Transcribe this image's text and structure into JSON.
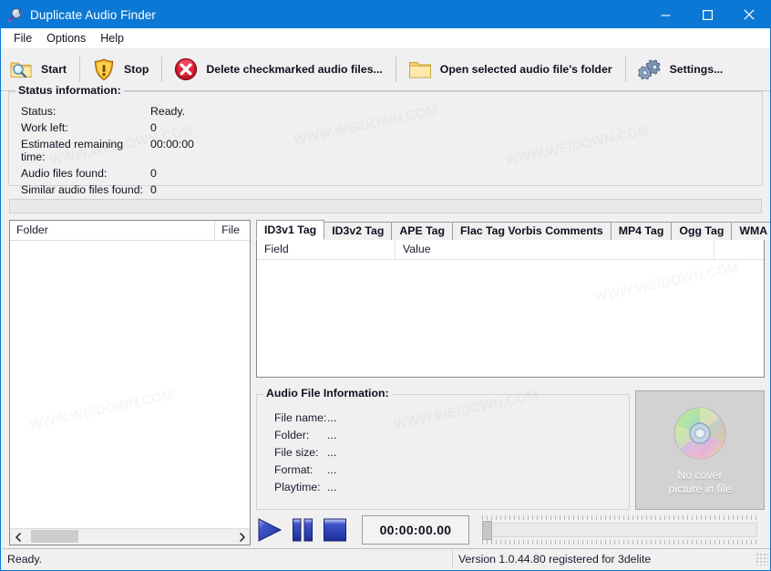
{
  "window": {
    "title": "Duplicate Audio Finder",
    "icon": "app-magnifier-icon",
    "minimize_label": "—",
    "maximize_label": "□",
    "close_label": "✕",
    "titlebar_color": "#0a78d4"
  },
  "menu": {
    "items": [
      {
        "label": "File"
      },
      {
        "label": "Options"
      },
      {
        "label": "Help"
      }
    ]
  },
  "toolbar": {
    "buttons": [
      {
        "label": "Start",
        "icon": "folder-search-icon"
      },
      {
        "label": "Stop",
        "icon": "shield-warning-icon"
      },
      {
        "label": "Delete checkmarked audio files...",
        "icon": "delete-x-icon"
      },
      {
        "label": "Open selected audio file's folder",
        "icon": "folder-icon"
      },
      {
        "label": "Settings...",
        "icon": "gears-icon"
      }
    ]
  },
  "status_information": {
    "title": "Status information:",
    "rows": [
      {
        "label": "Status:",
        "value": "Ready."
      },
      {
        "label": "Work left:",
        "value": "0"
      },
      {
        "label": "Estimated remaining time:",
        "value": "00:00:00"
      },
      {
        "label": "Audio files found:",
        "value": "0"
      },
      {
        "label": "Similar audio files found:",
        "value": "0"
      }
    ]
  },
  "progress": {
    "percent": 0
  },
  "folder_list": {
    "columns": [
      {
        "label": "Folder"
      },
      {
        "label": "File"
      }
    ],
    "rows": [],
    "scroll_left_icon": "chevron-left-icon",
    "scroll_right_icon": "chevron-right-icon"
  },
  "tag_tabs": {
    "active": "ID3v1 Tag",
    "items": [
      {
        "label": "ID3v1 Tag"
      },
      {
        "label": "ID3v2 Tag"
      },
      {
        "label": "APE Tag"
      },
      {
        "label": "Flac Tag Vorbis Comments"
      },
      {
        "label": "MP4 Tag"
      },
      {
        "label": "Ogg Tag"
      },
      {
        "label": "WMA Tag"
      }
    ]
  },
  "tag_list": {
    "columns": [
      {
        "label": "Field"
      },
      {
        "label": "Value"
      }
    ],
    "rows": []
  },
  "audio_file_information": {
    "title": "Audio File Information:",
    "rows": [
      {
        "label": "File name:",
        "value": "..."
      },
      {
        "label": "Folder:",
        "value": "..."
      },
      {
        "label": "File size:",
        "value": "..."
      },
      {
        "label": "Format:",
        "value": "..."
      },
      {
        "label": "Playtime:",
        "value": "..."
      }
    ]
  },
  "cover": {
    "icon": "compact-disc-icon",
    "line1": "No cover",
    "line2": "picture in file"
  },
  "transport": {
    "play_icon": "play-icon",
    "pause_icon": "pause-icon",
    "stop_icon": "stop-icon",
    "time": "00:00:00.00",
    "seek_value": 0
  },
  "statusbar": {
    "left": "Ready.",
    "right": "Version 1.0.44.80 registered for 3delite"
  },
  "watermarks": [
    "WWW.WEIDOWN.COM",
    "WWW.WEIDOWN.COM",
    "WWW.WEIDOWN.COM",
    "WWW.WEIDOWN.COM",
    "WWW.WEIDOWN.COM",
    "WWW.WEIDOWN.COM"
  ]
}
